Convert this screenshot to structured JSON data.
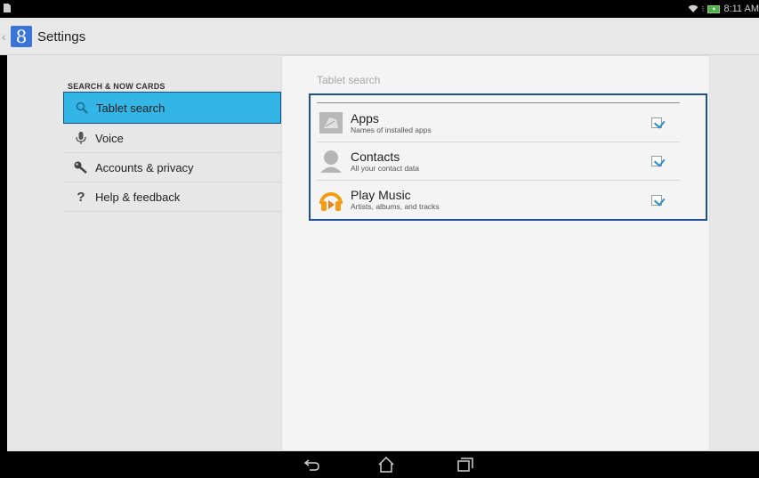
{
  "status_bar": {
    "time": "8:11 AM"
  },
  "action_bar": {
    "app_glyph": "8",
    "title": "Settings"
  },
  "left_pane": {
    "section_header": "SEARCH & NOW CARDS",
    "items": [
      {
        "label": "Tablet search",
        "icon": "search-icon",
        "selected": true
      },
      {
        "label": "Voice",
        "icon": "microphone-icon",
        "selected": false
      },
      {
        "label": "Accounts & privacy",
        "icon": "key-icon",
        "selected": false
      },
      {
        "label": "Help & feedback",
        "icon": "question-icon",
        "selected": false
      }
    ]
  },
  "right_pane": {
    "title": "Tablet search",
    "sources": [
      {
        "name": "Apps",
        "description": "Names of installed apps",
        "icon": "apps-icon",
        "checked": true
      },
      {
        "name": "Contacts",
        "description": "All your contact data",
        "icon": "contact-icon",
        "checked": true
      },
      {
        "name": "Play Music",
        "description": "Artists, albums, and tracks",
        "icon": "play-music-icon",
        "checked": true
      }
    ]
  },
  "colors": {
    "accent": "#33b5e5",
    "highlight_border": "#1f4f8c",
    "checkmark": "#2c93c4",
    "app_icon": "#3a74d8"
  },
  "nav_bar": {
    "buttons": [
      "back-icon",
      "home-icon",
      "recents-icon"
    ]
  }
}
